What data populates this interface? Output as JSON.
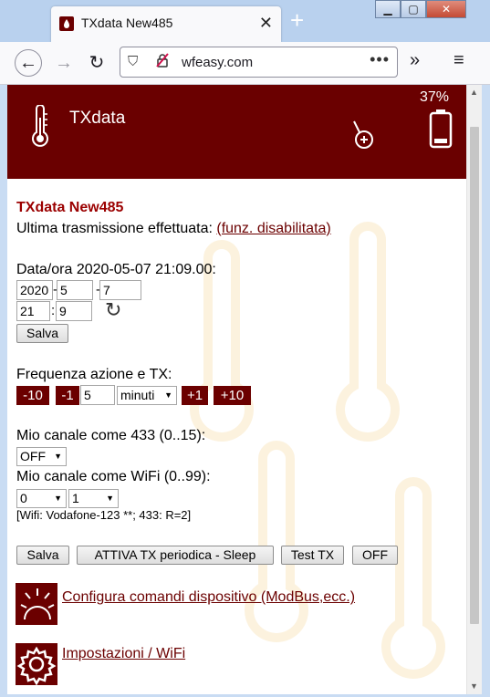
{
  "browser": {
    "tab_title": "TXdata New485",
    "tab_close": "✕",
    "new_tab": "+",
    "url": "wfeasy.com",
    "url_more": "•••",
    "window_buttons": {
      "minimize": "▁",
      "maximize": "▢",
      "close": "✕"
    }
  },
  "header": {
    "title": "TXdata",
    "battery_percent": "37%",
    "battery_level": 0.37,
    "icons": {
      "left": "thermometer-icon",
      "pin": "location-add-icon",
      "battery": "battery-icon"
    }
  },
  "device": {
    "name": "TXdata New485",
    "last_tx_label": "Ultima trasmissione effettuata: ",
    "last_tx_value": "(funz. disabilitata)"
  },
  "datetime": {
    "label": "Data/ora 2020-05-07 21:09.00:",
    "year": "2020",
    "month": "5",
    "day": "7",
    "hour": "21",
    "minute": "9",
    "date_sep": "-",
    "time_sep": ":",
    "save_label": "Salva"
  },
  "frequency": {
    "label": "Frequenza azione e TX:",
    "minus10": "-10",
    "minus1": "-1",
    "value": "5",
    "unit": "minuti",
    "plus1": "+1",
    "plus10": "+10"
  },
  "channels": {
    "ch433_label": "Mio canale come 433 (0..15):",
    "ch433_value": "OFF",
    "wifi_label": "Mio canale come WiFi (0..99):",
    "wifi_tens": "0",
    "wifi_units": "1",
    "info": "[Wifi: Vodafone-123 **; 433: R=2]"
  },
  "actions": {
    "save": "Salva",
    "activate": "ATTIVA TX periodica - Sleep",
    "test": "Test TX",
    "off": "OFF"
  },
  "menu": {
    "commands": "Configura comandi dispositivo (ModBus,ecc.)",
    "settings": "Impostazioni / WiFi"
  },
  "colors": {
    "brand": "#6a0000",
    "accent_text": "#9b0000"
  }
}
